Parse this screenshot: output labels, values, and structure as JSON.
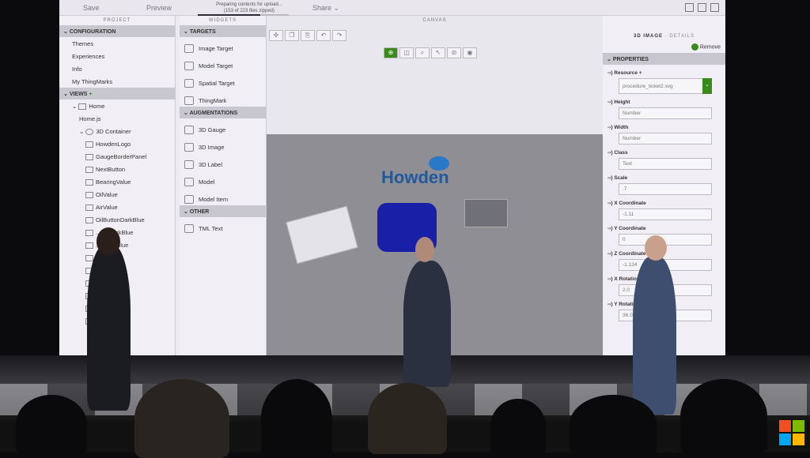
{
  "topbar": {
    "save": "Save",
    "preview": "Preview",
    "upload_status": "Preparing contents for upload...",
    "upload_detail": "(153 of 223 files zipped)",
    "upload_progress": 0.69,
    "share": "Share"
  },
  "project": {
    "header": "PROJECT",
    "configuration": "CONFIGURATION",
    "config_items": [
      "Themes",
      "Experiences",
      "Info",
      "My ThingMarks"
    ],
    "views": "VIEWS",
    "home": "Home",
    "homejs": "Home.js",
    "container": "3D Container",
    "children": [
      "HowdenLogo",
      "GaugeBorderPanel",
      "NextButton",
      "BearingValue",
      "OilValue",
      "AirValue",
      "OilButtonDarkBlue",
      "...tonDarkBlue",
      "...nDarkBlue",
      "...mage",
      "...e",
      "...Image",
      "...e",
      "...derPanel",
      "...ue"
    ]
  },
  "widgets": {
    "header": "WIDGETS",
    "targets": "TARGETS",
    "target_items": [
      "Image Target",
      "Model Target",
      "Spatial Target",
      "ThingMark"
    ],
    "augmentations": "AUGMENTATIONS",
    "aug_items": [
      "3D Gauge",
      "3D Image",
      "3D Label",
      "Model",
      "Model Item"
    ],
    "other": "OTHER",
    "other_items": [
      "TML Text"
    ]
  },
  "canvas": {
    "header": "CANVAS",
    "logo_text": "Howden"
  },
  "details": {
    "header": "3D IMAGE",
    "header_sub": "· DETAILS",
    "remove": "Remove",
    "properties": "PROPERTIES",
    "resource_label": "Resource",
    "resource_value": "procedure_ticket2.svg",
    "props": [
      {
        "label": "Height",
        "value": "Number"
      },
      {
        "label": "Width",
        "value": "Number"
      },
      {
        "label": "Class",
        "value": "Text"
      },
      {
        "label": "Scale",
        "value": ".7"
      },
      {
        "label": "X Coordinate",
        "value": "-1.11"
      },
      {
        "label": "Y Coordinate",
        "value": "0"
      },
      {
        "label": "Z Coordinate",
        "value": "-1.134"
      },
      {
        "label": "X Rotation",
        "value": "2.0"
      },
      {
        "label": "Y Rotation",
        "value": "36.08"
      }
    ]
  },
  "colors": {
    "accent": "#3a8a1e",
    "logo": "#1f5a9e",
    "model": "#1a1fa8"
  }
}
